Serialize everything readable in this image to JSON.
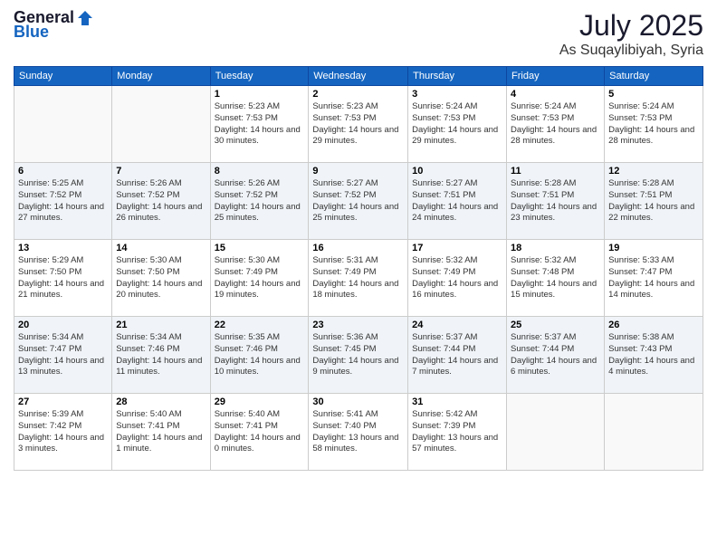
{
  "header": {
    "logo_general": "General",
    "logo_blue": "Blue",
    "month": "July 2025",
    "location": "As Suqaylibiyah, Syria"
  },
  "days_of_week": [
    "Sunday",
    "Monday",
    "Tuesday",
    "Wednesday",
    "Thursday",
    "Friday",
    "Saturday"
  ],
  "weeks": [
    [
      {
        "day": "",
        "info": ""
      },
      {
        "day": "",
        "info": ""
      },
      {
        "day": "1",
        "info": "Sunrise: 5:23 AM\nSunset: 7:53 PM\nDaylight: 14 hours and 30 minutes."
      },
      {
        "day": "2",
        "info": "Sunrise: 5:23 AM\nSunset: 7:53 PM\nDaylight: 14 hours and 29 minutes."
      },
      {
        "day": "3",
        "info": "Sunrise: 5:24 AM\nSunset: 7:53 PM\nDaylight: 14 hours and 29 minutes."
      },
      {
        "day": "4",
        "info": "Sunrise: 5:24 AM\nSunset: 7:53 PM\nDaylight: 14 hours and 28 minutes."
      },
      {
        "day": "5",
        "info": "Sunrise: 5:24 AM\nSunset: 7:53 PM\nDaylight: 14 hours and 28 minutes."
      }
    ],
    [
      {
        "day": "6",
        "info": "Sunrise: 5:25 AM\nSunset: 7:52 PM\nDaylight: 14 hours and 27 minutes."
      },
      {
        "day": "7",
        "info": "Sunrise: 5:26 AM\nSunset: 7:52 PM\nDaylight: 14 hours and 26 minutes."
      },
      {
        "day": "8",
        "info": "Sunrise: 5:26 AM\nSunset: 7:52 PM\nDaylight: 14 hours and 25 minutes."
      },
      {
        "day": "9",
        "info": "Sunrise: 5:27 AM\nSunset: 7:52 PM\nDaylight: 14 hours and 25 minutes."
      },
      {
        "day": "10",
        "info": "Sunrise: 5:27 AM\nSunset: 7:51 PM\nDaylight: 14 hours and 24 minutes."
      },
      {
        "day": "11",
        "info": "Sunrise: 5:28 AM\nSunset: 7:51 PM\nDaylight: 14 hours and 23 minutes."
      },
      {
        "day": "12",
        "info": "Sunrise: 5:28 AM\nSunset: 7:51 PM\nDaylight: 14 hours and 22 minutes."
      }
    ],
    [
      {
        "day": "13",
        "info": "Sunrise: 5:29 AM\nSunset: 7:50 PM\nDaylight: 14 hours and 21 minutes."
      },
      {
        "day": "14",
        "info": "Sunrise: 5:30 AM\nSunset: 7:50 PM\nDaylight: 14 hours and 20 minutes."
      },
      {
        "day": "15",
        "info": "Sunrise: 5:30 AM\nSunset: 7:49 PM\nDaylight: 14 hours and 19 minutes."
      },
      {
        "day": "16",
        "info": "Sunrise: 5:31 AM\nSunset: 7:49 PM\nDaylight: 14 hours and 18 minutes."
      },
      {
        "day": "17",
        "info": "Sunrise: 5:32 AM\nSunset: 7:49 PM\nDaylight: 14 hours and 16 minutes."
      },
      {
        "day": "18",
        "info": "Sunrise: 5:32 AM\nSunset: 7:48 PM\nDaylight: 14 hours and 15 minutes."
      },
      {
        "day": "19",
        "info": "Sunrise: 5:33 AM\nSunset: 7:47 PM\nDaylight: 14 hours and 14 minutes."
      }
    ],
    [
      {
        "day": "20",
        "info": "Sunrise: 5:34 AM\nSunset: 7:47 PM\nDaylight: 14 hours and 13 minutes."
      },
      {
        "day": "21",
        "info": "Sunrise: 5:34 AM\nSunset: 7:46 PM\nDaylight: 14 hours and 11 minutes."
      },
      {
        "day": "22",
        "info": "Sunrise: 5:35 AM\nSunset: 7:46 PM\nDaylight: 14 hours and 10 minutes."
      },
      {
        "day": "23",
        "info": "Sunrise: 5:36 AM\nSunset: 7:45 PM\nDaylight: 14 hours and 9 minutes."
      },
      {
        "day": "24",
        "info": "Sunrise: 5:37 AM\nSunset: 7:44 PM\nDaylight: 14 hours and 7 minutes."
      },
      {
        "day": "25",
        "info": "Sunrise: 5:37 AM\nSunset: 7:44 PM\nDaylight: 14 hours and 6 minutes."
      },
      {
        "day": "26",
        "info": "Sunrise: 5:38 AM\nSunset: 7:43 PM\nDaylight: 14 hours and 4 minutes."
      }
    ],
    [
      {
        "day": "27",
        "info": "Sunrise: 5:39 AM\nSunset: 7:42 PM\nDaylight: 14 hours and 3 minutes."
      },
      {
        "day": "28",
        "info": "Sunrise: 5:40 AM\nSunset: 7:41 PM\nDaylight: 14 hours and 1 minute."
      },
      {
        "day": "29",
        "info": "Sunrise: 5:40 AM\nSunset: 7:41 PM\nDaylight: 14 hours and 0 minutes."
      },
      {
        "day": "30",
        "info": "Sunrise: 5:41 AM\nSunset: 7:40 PM\nDaylight: 13 hours and 58 minutes."
      },
      {
        "day": "31",
        "info": "Sunrise: 5:42 AM\nSunset: 7:39 PM\nDaylight: 13 hours and 57 minutes."
      },
      {
        "day": "",
        "info": ""
      },
      {
        "day": "",
        "info": ""
      }
    ]
  ]
}
